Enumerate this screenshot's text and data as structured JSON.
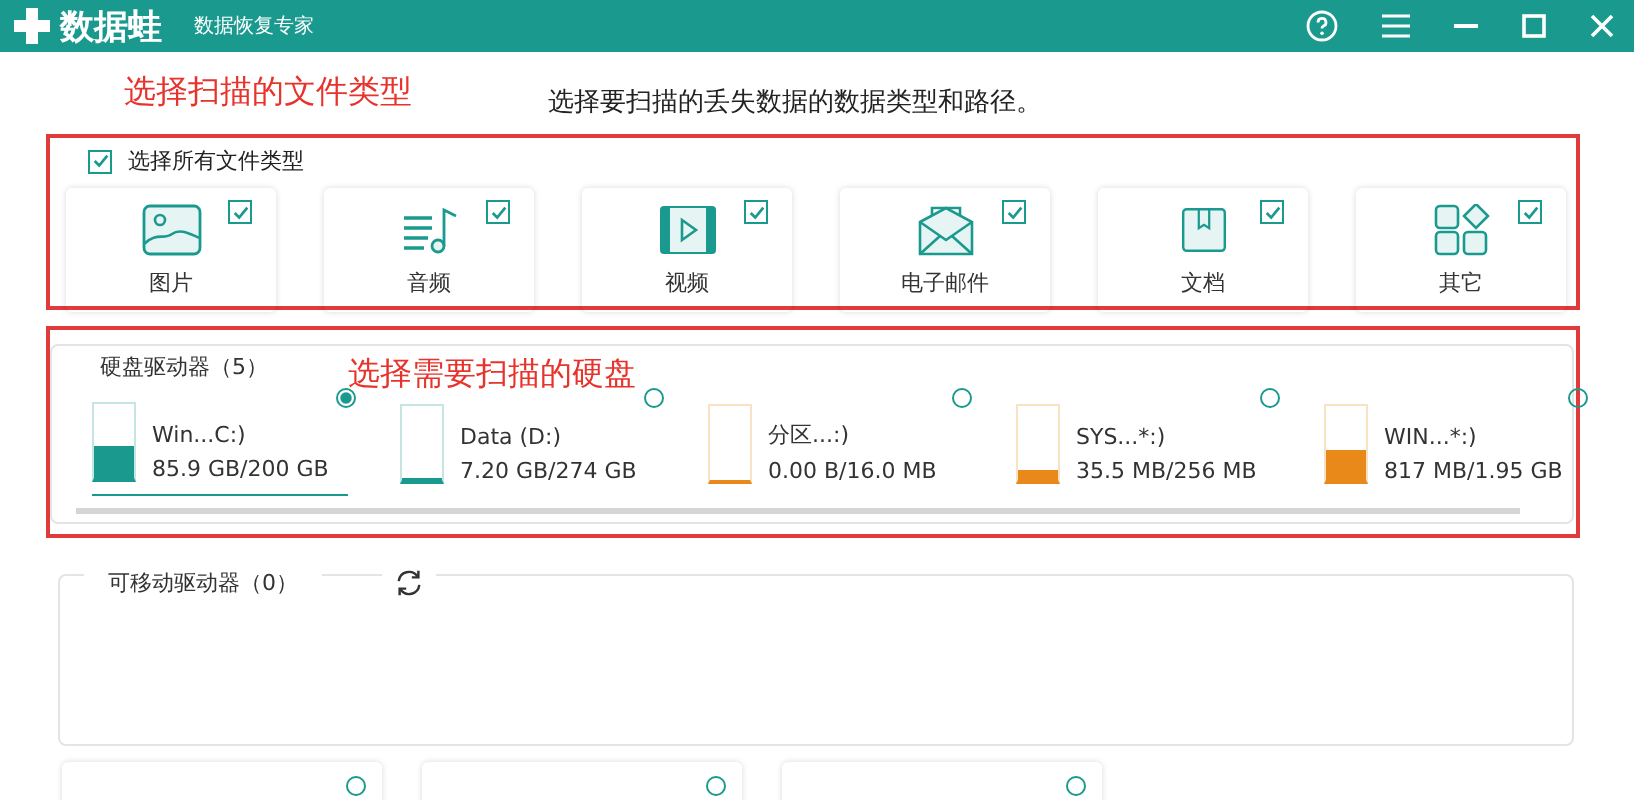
{
  "app": {
    "logo": "数据蛙",
    "subtitle": "数据恢复专家"
  },
  "annotations": {
    "file_types": "选择扫描的文件类型",
    "drives": "选择需要扫描的硬盘"
  },
  "instruction": "选择要扫描的丢失数据的数据类型和路径。",
  "select_all": {
    "label": "选择所有文件类型",
    "checked": true
  },
  "file_types": [
    {
      "label": "图片",
      "checked": true
    },
    {
      "label": "音频",
      "checked": true
    },
    {
      "label": "视频",
      "checked": true
    },
    {
      "label": "电子邮件",
      "checked": true
    },
    {
      "label": "文档",
      "checked": true
    },
    {
      "label": "其它",
      "checked": true
    }
  ],
  "hard_drives": {
    "title": "硬盘驱动器（5）",
    "items": [
      {
        "name": "Win...C:)",
        "usage": "85.9 GB/200 GB",
        "level": 0.43,
        "color": "#1a9a8f",
        "selected": true
      },
      {
        "name": "Data (D:)",
        "usage": "7.20 GB/274 GB",
        "level": 0.03,
        "color": "#1a9a8f",
        "selected": false
      },
      {
        "name": "分区...:)",
        "usage": "0.00  B/16.0 MB",
        "level": 0,
        "color": "#e8891a",
        "selected": false
      },
      {
        "name": "SYS...*:)",
        "usage": "35.5 MB/256 MB",
        "level": 0.14,
        "color": "#e8891a",
        "selected": false
      },
      {
        "name": "WIN...*:)",
        "usage": "817 MB/1.95 GB",
        "level": 0.41,
        "color": "#e8891a",
        "selected": false
      }
    ]
  },
  "removable_drives": {
    "title": "可移动驱动器（0）"
  },
  "bottom_cards": [
    {
      "selected": false
    },
    {
      "selected": false
    },
    {
      "selected": false
    }
  ]
}
